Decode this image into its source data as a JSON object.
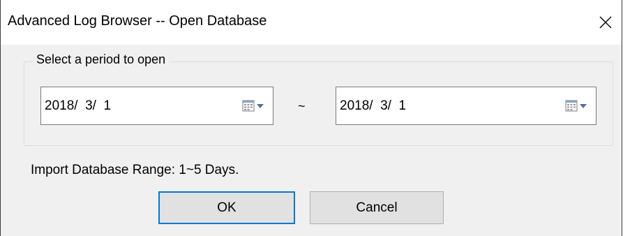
{
  "window": {
    "title": "Advanced Log Browser -- Open Database",
    "close_icon": "close-icon"
  },
  "period_group": {
    "legend": "Select a period to open",
    "start_date": "2018/  3/  1",
    "end_date": "2018/  3/  1",
    "separator": "~",
    "picker_icon": "calendar-dropdown-icon"
  },
  "info": {
    "range_text": "Import Database Range: 1~5 Days."
  },
  "buttons": {
    "ok_label": "OK",
    "cancel_label": "Cancel"
  },
  "colors": {
    "focus_border": "#0078d7",
    "dialog_bg": "#f0f0f0"
  }
}
